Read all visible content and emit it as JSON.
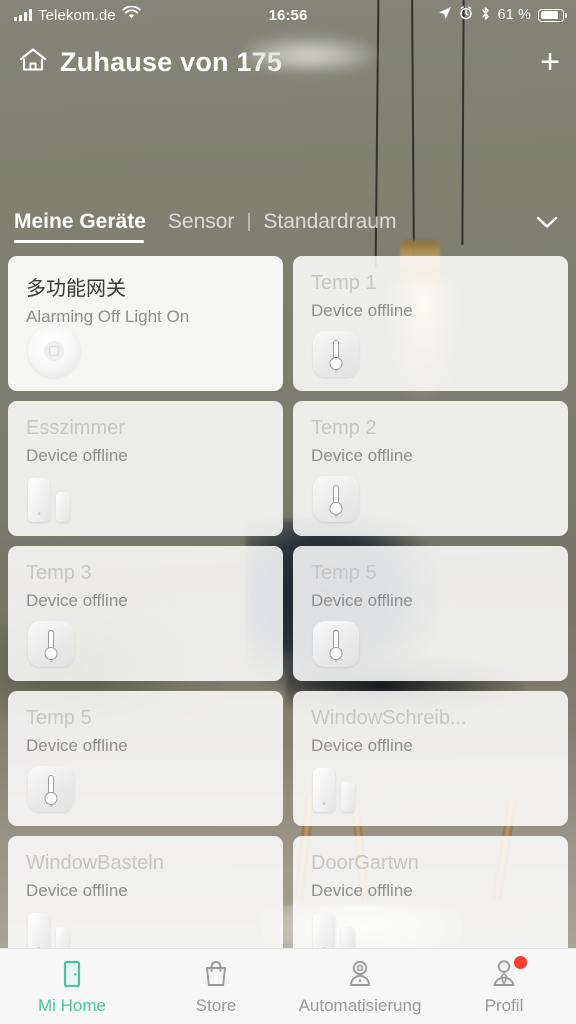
{
  "statusbar": {
    "carrier": "Telekom.de",
    "time": "16:56",
    "battery_percent": "61 %",
    "signal_icon": "cellular-bars-icon",
    "wifi_icon": "wifi-icon",
    "location_icon": "location-arrow-icon",
    "alarm_icon": "alarm-clock-icon",
    "bluetooth_icon": "bluetooth-icon",
    "battery_icon": "battery-icon"
  },
  "header": {
    "home_icon": "home-icon",
    "title": "Zuhause von 175",
    "add_label": "+"
  },
  "tabs": {
    "items": [
      {
        "label": "Meine Geräte",
        "active": true
      },
      {
        "label": "Sensor",
        "active": false
      }
    ],
    "separator": "|",
    "room": "Standardraum",
    "chevron_icon": "chevron-down-icon"
  },
  "devices": [
    {
      "name": "多功能网关",
      "status": "Alarming Off Light On",
      "icon": "gateway-icon",
      "online": true
    },
    {
      "name": "Temp 1",
      "status": "Device offline",
      "icon": "thermometer-icon",
      "online": false
    },
    {
      "name": "Esszimmer",
      "status": "Device offline",
      "icon": "door-window-sensor-icon",
      "online": false
    },
    {
      "name": "Temp 2",
      "status": "Device offline",
      "icon": "thermometer-icon",
      "online": false
    },
    {
      "name": "Temp 3",
      "status": "Device offline",
      "icon": "thermometer-icon",
      "online": false
    },
    {
      "name": "Temp 5",
      "status": "Device offline",
      "icon": "thermometer-icon",
      "online": false
    },
    {
      "name": "Temp 5",
      "status": "Device offline",
      "icon": "thermometer-icon",
      "online": false
    },
    {
      "name": "WindowSchreib...",
      "status": "Device offline",
      "icon": "door-window-sensor-icon",
      "online": false
    },
    {
      "name": "WindowBasteln",
      "status": "Device offline",
      "icon": "door-window-sensor-icon",
      "online": false
    },
    {
      "name": "DoorGartwn",
      "status": "Device offline",
      "icon": "door-window-sensor-icon",
      "online": false
    }
  ],
  "bottomnav": {
    "items": [
      {
        "label": "Mi Home",
        "icon": "door-icon",
        "active": true,
        "badge": false
      },
      {
        "label": "Store",
        "icon": "shopping-bag-icon",
        "active": false,
        "badge": false
      },
      {
        "label": "Automatisierung",
        "icon": "camera-robot-icon",
        "active": false,
        "badge": false
      },
      {
        "label": "Profil",
        "icon": "person-icon",
        "active": false,
        "badge": true
      }
    ]
  },
  "colors": {
    "accent": "#4cc2a1",
    "badge": "#ff3b30",
    "card_bg": "#ffffff",
    "offline_title": "#c6c6c6",
    "status_text": "#8e8e8e",
    "nav_inactive": "#9b9b9b"
  }
}
